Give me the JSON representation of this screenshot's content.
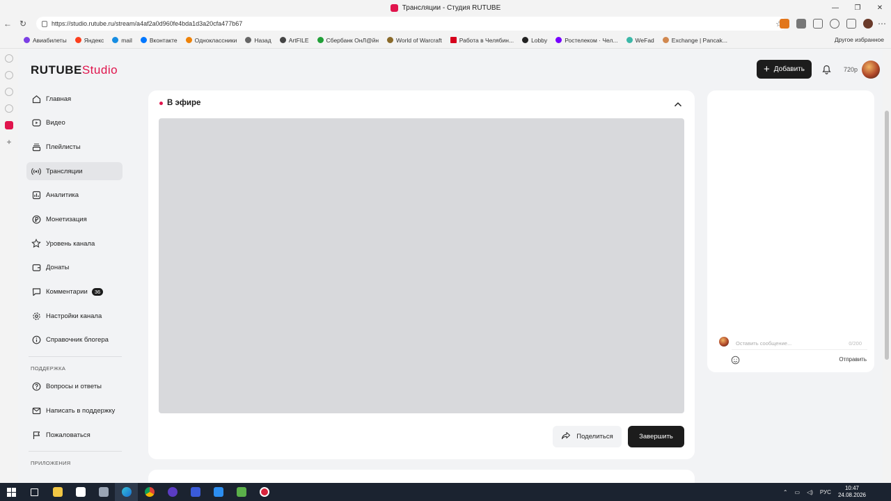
{
  "browser": {
    "window_title": "Трансляции - Студия RUTUBE",
    "url": "https://studio.rutube.ru/stream/a4af2a0d960fe4bda1d3a20cfa477b67",
    "bookmarks": [
      {
        "label": "Авиабилеты",
        "color": "#7b3fe4"
      },
      {
        "label": "Яндекс",
        "color": "#fc3f1d"
      },
      {
        "label": "mail",
        "color": "#168de2"
      },
      {
        "label": "Вконтакте",
        "color": "#0077ff"
      },
      {
        "label": "Одноклассники",
        "color": "#ee8208"
      },
      {
        "label": "Назад",
        "color": "#666666"
      },
      {
        "label": "ArtFILE",
        "color": "#444444"
      },
      {
        "label": "Сбербанк ОнЛ@йн",
        "color": "#21a038"
      },
      {
        "label": "World of Warcraft",
        "color": "#8a6a2a"
      },
      {
        "label": "Работа в Челябин...",
        "color": "#d6001c"
      },
      {
        "label": "Lobby",
        "color": "#222222"
      },
      {
        "label": "Ростелеком · Чел...",
        "color": "#7700ff"
      },
      {
        "label": "WeFad",
        "color": "#3bb8a8"
      },
      {
        "label": "Exchange | Pancak...",
        "color": "#d1884f"
      }
    ],
    "other_bookmarks": "Другое избранное"
  },
  "header": {
    "logo_main": "RUTUBE",
    "logo_studio": "Studio",
    "add_button": "Добавить",
    "quality": "720p"
  },
  "sidebar": {
    "items": [
      {
        "label": "Главная",
        "icon": "home-icon"
      },
      {
        "label": "Видео",
        "icon": "video-icon"
      },
      {
        "label": "Плейлисты",
        "icon": "playlist-icon"
      },
      {
        "label": "Трансляции",
        "icon": "broadcast-icon"
      },
      {
        "label": "Аналитика",
        "icon": "analytics-icon"
      },
      {
        "label": "Монетизация",
        "icon": "ruble-icon"
      },
      {
        "label": "Уровень канала",
        "icon": "star-icon"
      },
      {
        "label": "Донаты",
        "icon": "wallet-icon"
      },
      {
        "label": "Комментарии",
        "icon": "comment-icon",
        "badge": "36"
      },
      {
        "label": "Настройки канала",
        "icon": "gear-icon"
      },
      {
        "label": "Справочник блогера",
        "icon": "info-icon"
      }
    ],
    "support_label": "ПОДДЕРЖКА",
    "support_items": [
      {
        "label": "Вопросы и ответы",
        "icon": "question-icon"
      },
      {
        "label": "Написать в поддержку",
        "icon": "mail-icon"
      },
      {
        "label": "Пожаловаться",
        "icon": "flag-icon"
      }
    ],
    "apps_label": "ПРИЛОЖЕНИЯ"
  },
  "stream": {
    "status": "В эфире",
    "share_button": "Поделиться",
    "end_button": "Завершить"
  },
  "chat": {
    "placeholder": "Оставить сообщение...",
    "counter": "0/200",
    "send": "Отправить"
  },
  "taskbar": {
    "lang": "РУС",
    "time": "10:47",
    "date": "24.08.2026"
  },
  "colors": {
    "accent": "#e0144c",
    "dark": "#1c1c1c"
  }
}
